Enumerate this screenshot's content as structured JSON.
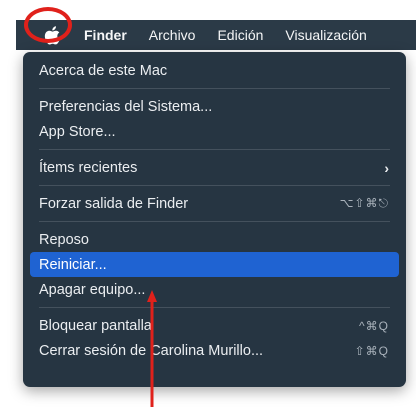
{
  "colors": {
    "menubar_bg": "#2b3a47",
    "menu_bg": "#263542",
    "highlight": "#1f63d2",
    "annotation": "#e0211b"
  },
  "menubar": {
    "apple_icon": "apple-logo",
    "items": [
      "Finder",
      "Archivo",
      "Edición",
      "Visualización"
    ]
  },
  "menu": {
    "items": [
      {
        "label": "Acerca de este Mac"
      },
      {
        "label": "Preferencias del Sistema..."
      },
      {
        "label": "App Store..."
      },
      {
        "label": "Ítems recientes",
        "submenu": "›"
      },
      {
        "label": "Forzar salida de Finder",
        "shortcut": "⌥⇧⌘⎋"
      },
      {
        "label": "Reposo"
      },
      {
        "label": "Reiniciar...",
        "highlighted": true
      },
      {
        "label": "Apagar equipo..."
      },
      {
        "label": "Bloquear pantalla",
        "shortcut": "^⌘Q"
      },
      {
        "label": "Cerrar sesión de Carolina Murillo...",
        "shortcut": "⇧⌘Q"
      }
    ]
  }
}
